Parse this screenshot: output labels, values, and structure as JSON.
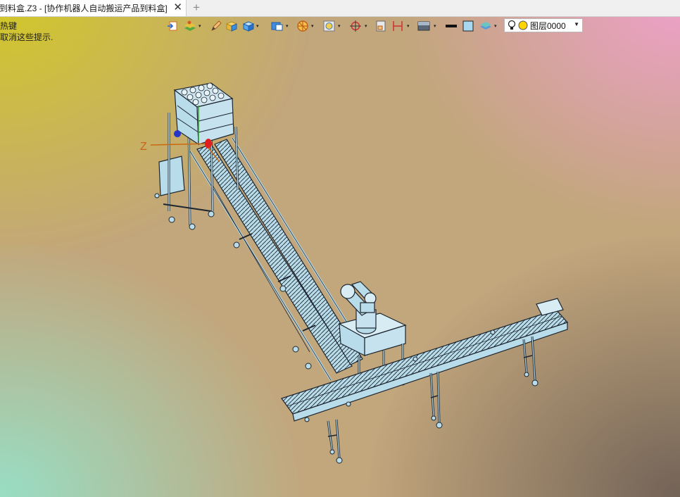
{
  "window": {
    "tab_title": "到料盒.Z3 - [协作机器人自动搬运产品到料盒]",
    "close_glyph": "✕",
    "add_glyph": "+"
  },
  "hints": {
    "line1": "热键",
    "line2": "取消这些提示."
  },
  "toolbar": {
    "layer_value": "图层0000"
  },
  "viewport": {
    "axis_label": "Z",
    "model_color": "#b8dcea",
    "edge_color": "#1d2630"
  }
}
